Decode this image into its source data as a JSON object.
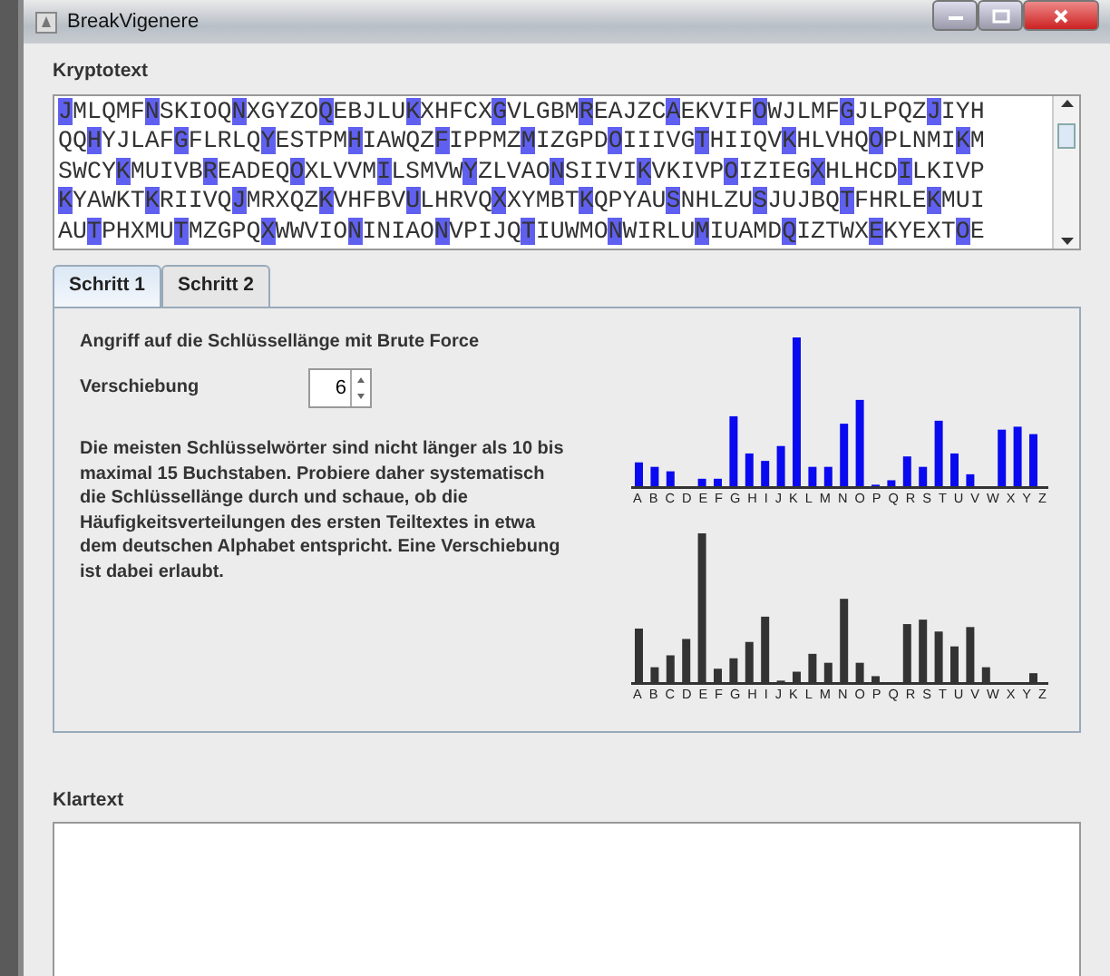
{
  "window": {
    "title": "BreakVigenere"
  },
  "ciphertext": {
    "label": "Kryptotext",
    "lines": [
      {
        "groups": [
          "JMLQMF",
          "NSKIOQ",
          "NXGYZO",
          "QEBJLU",
          "KXHFCX",
          "GVLGBM",
          "REAJZC",
          "AEKVIF",
          "OWJLMF",
          "GJLPQZ",
          "JIYH"
        ]
      },
      {
        "lead": "QQ",
        "groups": [
          "HYJLAF",
          "GFLRLQ",
          "YESTPM",
          "HIAWQZ",
          "FIPPMZ",
          "MIZGPD",
          "OIIIVG",
          "THIIQV",
          "KHLVHQ",
          "OPLNMI",
          "KM"
        ]
      },
      {
        "lead": "SWCY",
        "groups": [
          "KMUIVB",
          "READEQ",
          "OXLVVM",
          "ILSMVW",
          "YZLVAO",
          "NSIIVI",
          "KVKIVP",
          "OIZIEG",
          "XHLHCD",
          "ILKIVP"
        ]
      },
      {
        "groups": [
          "KYAWKT",
          "KRIIVQ",
          "JMRXQZ",
          "KVHFBV",
          "ULHRVQ",
          "XXYMBT",
          "KQPYAU",
          "SNHLZU",
          "SJUJBQ",
          "TFHRLE",
          "KMUI"
        ]
      },
      {
        "lead": "AU",
        "groups": [
          "TPHXMU",
          "TMZGPQ",
          "XWWVIO",
          "NINIAO",
          "NVPIJQ",
          "TIUWMO",
          "NWIRLU",
          "MIUAMD",
          "QIZTWX",
          "EKYEXT",
          "OE"
        ]
      }
    ]
  },
  "tabs": [
    {
      "label": "Schritt 1",
      "selected": true
    },
    {
      "label": "Schritt 2",
      "selected": false
    }
  ],
  "step": {
    "heading": "Angriff auf die Schlüssellänge mit Brute Force",
    "shift_label": "Verschiebung",
    "shift_value": "6",
    "description": "Die meisten Schlüsselwörter sind nicht länger als 10 bis maximal 15 Buchstaben. Probiere daher systematisch die Schlüssellänge durch und schaue, ob die Häufigkeitsverteilungen des ersten Teiltextes in etwa dem deutschen Alphabet entspricht. Eine Verschiebung ist dabei erlaubt.",
    "histograms": [
      {
        "kind": "subtext",
        "axis_labels": "ABCDEFGHIJKLMNOPQRSTUVWXYZ"
      },
      {
        "kind": "reference",
        "axis_labels": "ABCDEFGHIJKLMNOPQRSTUVWXYZ"
      }
    ]
  },
  "plaintext": {
    "label": "Klartext"
  }
}
